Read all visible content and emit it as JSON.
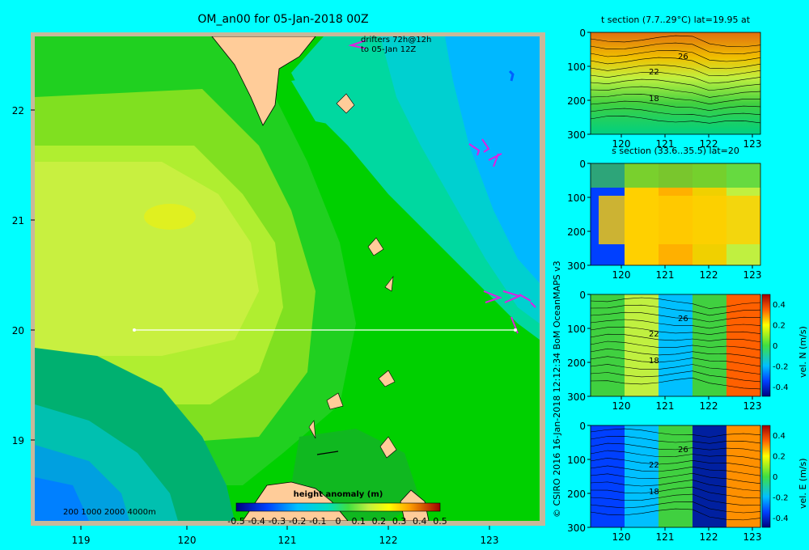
{
  "title": "OM_an00 for 05-Jan-2018 00Z",
  "drifters": {
    "line1": "drifters 72h@12h",
    "line2": "to 05-Jan 12Z"
  },
  "map": {
    "lon_ticks": [
      "119",
      "120",
      "121",
      "122",
      "123"
    ],
    "lat_ticks": [
      "22",
      "21",
      "20",
      "19"
    ],
    "depth_legend": "200  1000  2000  4000m",
    "colorbar_title": "height anomaly (m)",
    "colorbar_ticks": [
      "-0.5",
      "-0.4",
      "-0.3",
      "-0.2",
      "-0.1",
      "0",
      "0.1",
      "0.2",
      "0.3",
      "0.4",
      "0.5"
    ],
    "colors": {
      "background": "#00ffff",
      "land": "#ffcc99",
      "frame": "#bbbbaa"
    }
  },
  "credit": "© CSIRO 2016   16-Jan-2018 12:12:34 BoM OceanMAPS v3",
  "panels": [
    {
      "title": "t section (7.7..29°C) lat=19.95 at",
      "x_ticks": [
        "120",
        "121",
        "122",
        "123"
      ],
      "y_ticks": [
        "0",
        "100",
        "200",
        "300"
      ],
      "contour_labels": [
        "26",
        "22",
        "18"
      ]
    },
    {
      "title": "s section (33.6..35.5) lat=20",
      "x_ticks": [
        "120",
        "121",
        "122",
        "123"
      ],
      "y_ticks": [
        "0",
        "100",
        "200",
        "300"
      ]
    },
    {
      "title": "",
      "x_ticks": [
        "120",
        "121",
        "122",
        "123"
      ],
      "y_ticks": [
        "0",
        "100",
        "200",
        "300"
      ],
      "contour_labels": [
        "26",
        "22",
        "18"
      ],
      "cbar_label": "vel. N (m/s)",
      "cbar_ticks": [
        "0.4",
        "0.2",
        "0",
        "-0.2",
        "-0.4"
      ]
    },
    {
      "title": "",
      "x_ticks": [
        "120",
        "121",
        "122",
        "123"
      ],
      "y_ticks": [
        "0",
        "100",
        "200",
        "300"
      ],
      "contour_labels": [
        "26",
        "22",
        "18"
      ],
      "cbar_label": "vel. E (m/s)",
      "cbar_ticks": [
        "0.4",
        "0.2",
        "0",
        "-0.2",
        "-0.4"
      ]
    }
  ]
}
